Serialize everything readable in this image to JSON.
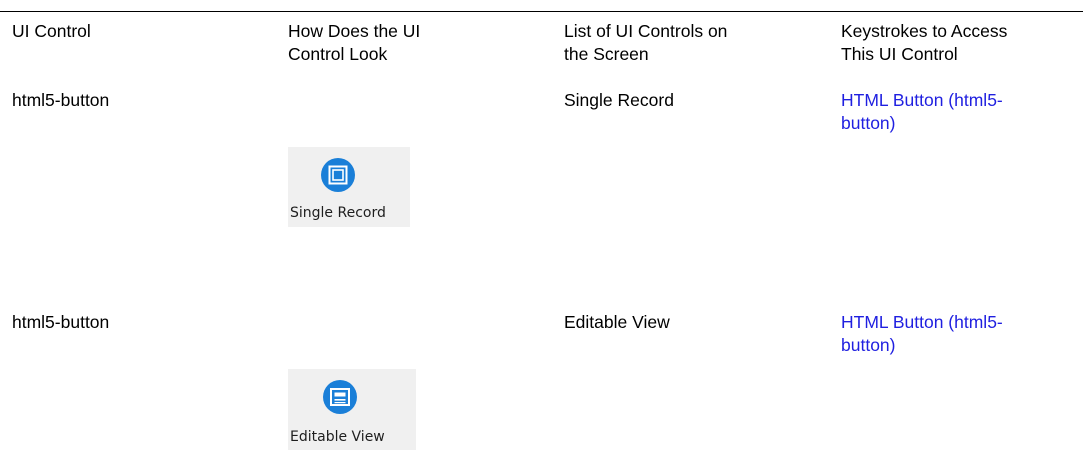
{
  "table": {
    "headers": [
      "UI Control",
      "How Does the UI\nControl Look",
      "List of UI Controls on\nthe Screen",
      "Keystrokes to Access\nThis UI Control"
    ],
    "rows": [
      {
        "ui_control": "html5-button",
        "icon_caption": "Single Record",
        "icon": "single-record-icon",
        "control_name": "Single Record",
        "keystroke_link": "HTML Button (html5-\nbutton)"
      },
      {
        "ui_control": "html5-button",
        "icon_caption": "Editable View",
        "icon": "editable-view-icon",
        "control_name": "Editable View",
        "keystroke_link": "HTML Button (html5-\nbutton)"
      }
    ]
  },
  "colors": {
    "link": "#1f1fe0",
    "icon_blue": "#1a7fd8",
    "icon_tile": "#f0f0f0"
  }
}
